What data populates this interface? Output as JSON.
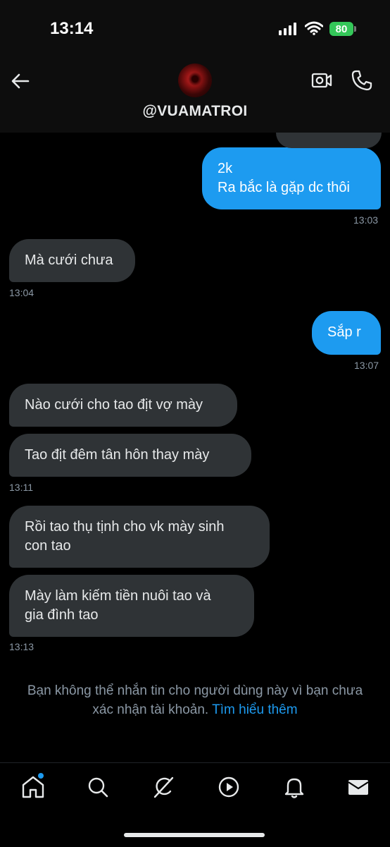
{
  "status_bar": {
    "time": "13:14",
    "battery": "80"
  },
  "header": {
    "handle": "@VUAMATROI"
  },
  "messages": [
    {
      "direction": "out",
      "lines": [
        "2k",
        "Ra bắc là gặp dc thôi"
      ],
      "time": "13:03"
    },
    {
      "direction": "in",
      "lines": [
        "Mà cưới chưa"
      ],
      "time": "13:04"
    },
    {
      "direction": "out",
      "lines": [
        "Sắp r"
      ],
      "time": "13:07"
    },
    {
      "direction": "in",
      "lines": [
        "Nào cưới cho tao địt vợ mày"
      ]
    },
    {
      "direction": "in",
      "lines": [
        "Tao địt đêm tân hôn thay mày"
      ],
      "time": "13:11"
    },
    {
      "direction": "in",
      "lines": [
        "Rồi tao thụ tịnh cho vk mày sinh",
        "con tao"
      ]
    },
    {
      "direction": "in",
      "lines": [
        "Mày làm kiếm tiền nuôi tao và",
        "gia đình tao"
      ],
      "time": "13:13"
    }
  ],
  "notice": {
    "line1": "Bạn không thể nhắn tin cho người dùng này vì bạn chưa",
    "line2": "xác nhận tài khoản.",
    "link": "Tìm hiểu thêm"
  },
  "tabbar": {
    "items": [
      {
        "icon": "home-icon",
        "active": true,
        "notification_dot": true
      },
      {
        "icon": "search-icon"
      },
      {
        "icon": "grok-icon"
      },
      {
        "icon": "play-icon"
      },
      {
        "icon": "bell-icon"
      },
      {
        "icon": "mail-icon"
      }
    ]
  },
  "colors": {
    "accent": "#1d9bf0",
    "incoming_bubble": "#2f3336",
    "background": "#000000"
  }
}
